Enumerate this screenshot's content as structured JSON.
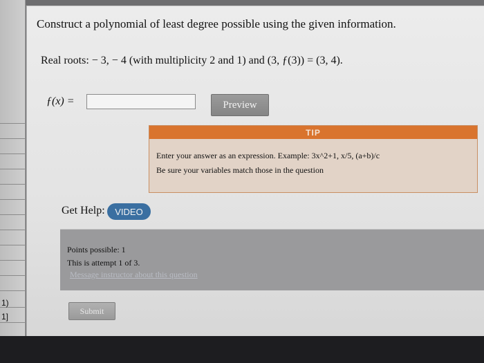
{
  "left_strip": {
    "marks": [
      "1)",
      "1]"
    ]
  },
  "question": {
    "title": "Construct a polynomial of least degree possible using the given information.",
    "roots": "Real roots: − 3, − 4 (with multiplicity 2 and 1) and (3, ƒ(3)) = (3, 4).",
    "answer_label": "ƒ(x) =",
    "answer_value": "",
    "preview_label": "Preview"
  },
  "tip": {
    "header": "TIP",
    "line1": "Enter your answer as an expression. Example: 3x^2+1, x/5, (a+b)/c",
    "line2": "Be sure your variables match those in the question"
  },
  "help": {
    "label": "Get Help:",
    "video_label": "VIDEO"
  },
  "points": {
    "possible": "Points possible: 1",
    "attempt": "This is attempt 1 of 3.",
    "message_link": "Message instructor about this question"
  },
  "submit_label": "Submit",
  "colors": {
    "tip_header": "#d9742e",
    "tip_bg": "#e2d3c7",
    "video_button": "#3a6fa1",
    "preview_button": "#8e8e8e"
  }
}
